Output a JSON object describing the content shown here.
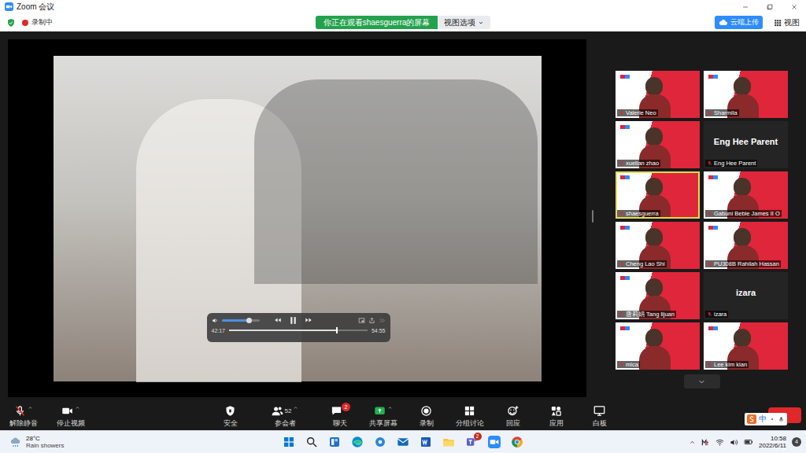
{
  "window": {
    "title": "Zoom 会议"
  },
  "recording": {
    "label": "录制中",
    "on": true
  },
  "banner": {
    "text": "你正在观看shaesguerra的屏幕",
    "view_options": "视图选项"
  },
  "top_actions": {
    "upload": "云端上传",
    "view": "视图"
  },
  "player": {
    "volume": 0.72,
    "elapsed": "42:17",
    "duration": "54:55",
    "progress": 0.77,
    "playing": true
  },
  "gallery": {
    "tiles": [
      {
        "name": "Valerie Neo",
        "kind": "video",
        "muted": true,
        "speaking": false
      },
      {
        "name": "Sharmila",
        "kind": "video",
        "muted": true,
        "speaking": false
      },
      {
        "name": "xuelian zhao",
        "kind": "video",
        "muted": true,
        "speaking": false
      },
      {
        "name": "Eng Hee Parent",
        "kind": "name",
        "muted": true,
        "speaking": false
      },
      {
        "name": "shaesguerra",
        "kind": "video",
        "muted": true,
        "speaking": true
      },
      {
        "name": "Gabuni Bebie James II O",
        "kind": "video",
        "muted": true,
        "speaking": false
      },
      {
        "name": "Cheng Lao Shi",
        "kind": "video",
        "muted": true,
        "speaking": false
      },
      {
        "name": "PU308B Rahilah Hassan",
        "kind": "video",
        "muted": true,
        "speaking": false
      },
      {
        "name": "唐莉娟 Tang lijuan",
        "kind": "video",
        "muted": true,
        "speaking": false
      },
      {
        "name": "izara",
        "kind": "name",
        "muted": true,
        "speaking": false
      },
      {
        "name": "mica",
        "kind": "video",
        "muted": true,
        "speaking": false
      },
      {
        "name": "Lee kim kian",
        "kind": "video",
        "muted": true,
        "speaking": false
      }
    ]
  },
  "toolbar": {
    "items": [
      {
        "label": "解除静音",
        "kind": "unmute",
        "highlighted": false
      },
      {
        "label": "停止视频",
        "kind": "video",
        "highlighted": false
      },
      {
        "label": "安全",
        "kind": "security",
        "highlighted": false
      },
      {
        "label": "参会者",
        "kind": "participants",
        "highlighted": false,
        "count": "52"
      },
      {
        "label": "聊天",
        "kind": "chat",
        "highlighted": false,
        "badge": "2"
      },
      {
        "label": "共享屏幕",
        "kind": "share",
        "highlighted": true
      },
      {
        "label": "录制",
        "kind": "record",
        "highlighted": false
      },
      {
        "label": "分组讨论",
        "kind": "breakout",
        "highlighted": false
      },
      {
        "label": "回应",
        "kind": "reactions",
        "highlighted": false
      },
      {
        "label": "应用",
        "kind": "apps",
        "highlighted": false
      },
      {
        "label": "白板",
        "kind": "whiteboard",
        "highlighted": false
      }
    ]
  },
  "ime": {
    "mode": "中"
  },
  "taskbar": {
    "temperature": "28°C",
    "weather": "Rain showers",
    "apps": [
      {
        "kind": "windows",
        "badge": ""
      },
      {
        "kind": "search",
        "badge": ""
      },
      {
        "kind": "widgets",
        "badge": ""
      },
      {
        "kind": "edge",
        "badge": ""
      },
      {
        "kind": "settings",
        "badge": ""
      },
      {
        "kind": "mail",
        "badge": ""
      },
      {
        "kind": "word",
        "badge": ""
      },
      {
        "kind": "folder",
        "badge": ""
      },
      {
        "kind": "teams",
        "badge": "2"
      },
      {
        "kind": "zoom",
        "badge": ""
      },
      {
        "kind": "chrome",
        "badge": ""
      }
    ],
    "time": "10:58",
    "date": "2022/6/11",
    "notifications": "4"
  }
}
